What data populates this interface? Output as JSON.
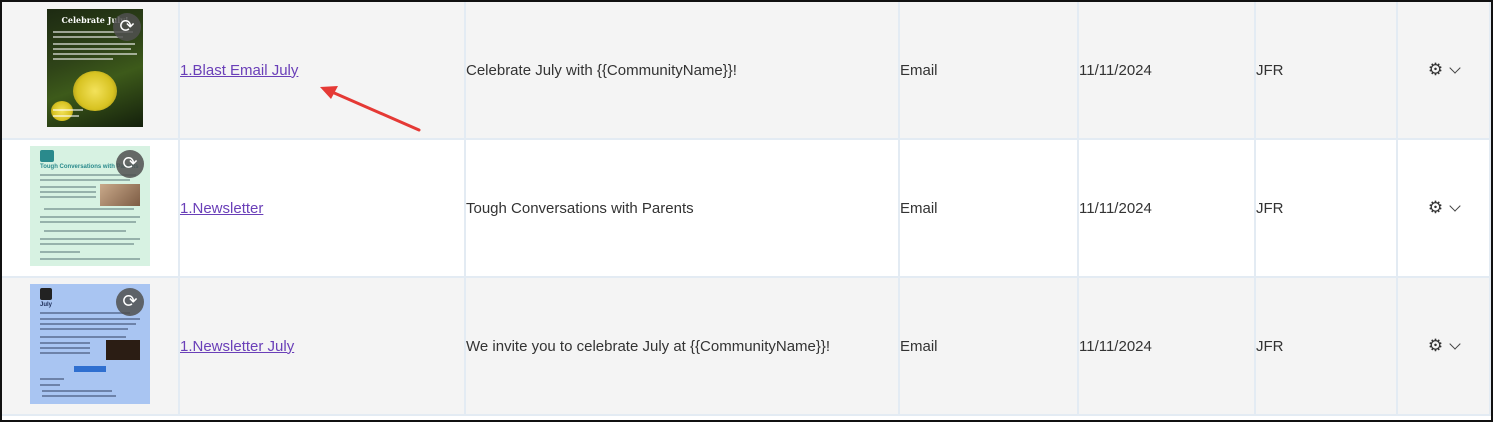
{
  "rows": [
    {
      "thumbnail_title": "Celebrate July!",
      "name": "1.Blast Email July",
      "subject": "Celebrate July with {{CommunityName}}!",
      "type": "Email",
      "date": "11/11/2024",
      "user": "JFR"
    },
    {
      "thumbnail_title": "Tough Conversations with Parents",
      "name": "1.Newsletter",
      "subject": "Tough Conversations with Parents",
      "type": "Email",
      "date": "11/11/2024",
      "user": "JFR"
    },
    {
      "thumbnail_title": "July",
      "name": "1.Newsletter July",
      "subject": "We invite you to celebrate July at {{CommunityName}}!",
      "type": "Email",
      "date": "11/11/2024",
      "user": "JFR"
    }
  ],
  "icons": {
    "refresh": "refresh-icon",
    "gear": "gear-icon",
    "chevron": "chevron-down-icon"
  },
  "colors": {
    "link": "#6a3fb8",
    "annotation_arrow": "#e53935",
    "row_alt": "#f4f4f4",
    "grid_line": "#e3ebf3"
  }
}
